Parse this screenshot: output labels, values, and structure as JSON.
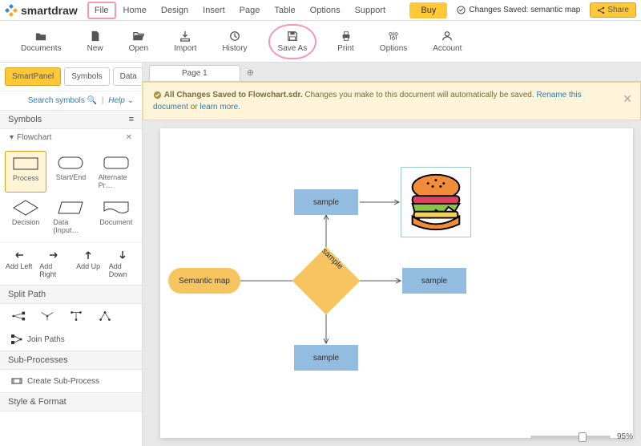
{
  "brand": "smartdraw",
  "menu": [
    "File",
    "Home",
    "Design",
    "Insert",
    "Page",
    "Table",
    "Options",
    "Support"
  ],
  "highlighted_menu": 0,
  "buy": "Buy",
  "saved_status": "Changes Saved: semantic map",
  "share": "Share",
  "toolbar": [
    {
      "id": "documents",
      "label": "Documents"
    },
    {
      "id": "new",
      "label": "New"
    },
    {
      "id": "open",
      "label": "Open"
    },
    {
      "id": "import",
      "label": "Import"
    },
    {
      "id": "history",
      "label": "History"
    },
    {
      "id": "saveas",
      "label": "Save As",
      "circled": true
    },
    {
      "id": "print",
      "label": "Print"
    },
    {
      "id": "options",
      "label": "Options"
    },
    {
      "id": "account",
      "label": "Account"
    }
  ],
  "panel": {
    "tabs": [
      "SmartPanel",
      "Symbols",
      "Data"
    ],
    "active_tab": 0,
    "search_link": "Search symbols",
    "help_link": "Help",
    "symbols_head": "Symbols",
    "category": "Flowchart",
    "shapes": [
      "Process",
      "Start/End",
      "Alternate Pr…",
      "Decision",
      "Data (Input…",
      "Document"
    ],
    "add": [
      "Add Left",
      "Add Right",
      "Add Up",
      "Add Down"
    ],
    "split_head": "Split Path",
    "join": "Join Paths",
    "sub_head": "Sub-Processes",
    "sub_item": "Create Sub-Process",
    "style_head": "Style & Format"
  },
  "doc": {
    "page_tab": "Page 1",
    "banner_bold": "All Changes Saved to Flowchart.sdr.",
    "banner_text": " Changes you make to this document will automatically be saved. ",
    "banner_link": "Rename this document",
    "banner_or": " or ",
    "banner_more": "learn more",
    "nodes": {
      "start": "Semantic map",
      "center": "sample",
      "top": "sample",
      "right": "sample",
      "bottom": "sample"
    },
    "zoom": "95%"
  }
}
